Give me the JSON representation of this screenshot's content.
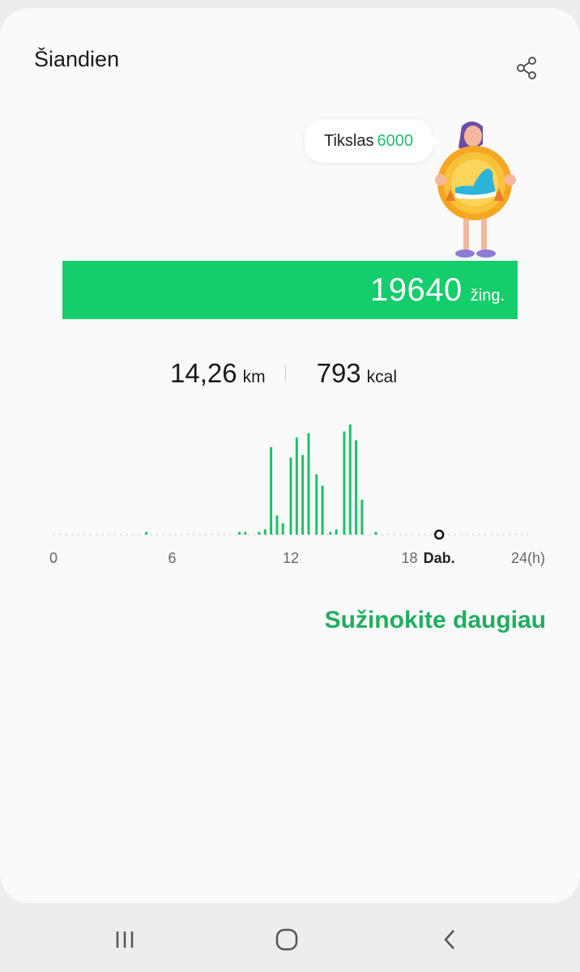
{
  "header": {
    "title": "Šiandien",
    "share_icon": "share-icon"
  },
  "goal": {
    "label": "Tikslas",
    "value": "6000",
    "value_color": "#1fbf6a"
  },
  "steps": {
    "value": "19640",
    "unit": "žing.",
    "progress_fraction": 1.0,
    "bar_color": "#14cd6b"
  },
  "stats": {
    "distance": {
      "value": "14,26",
      "unit": "km"
    },
    "calories": {
      "value": "793",
      "unit": "kcal"
    }
  },
  "chart_data": {
    "type": "bar",
    "x_ticks": [
      {
        "label": "0",
        "hour": 0
      },
      {
        "label": "6",
        "hour": 6
      },
      {
        "label": "12",
        "hour": 12
      },
      {
        "label": "18",
        "hour": 18
      },
      {
        "label": "24(h)",
        "hour": 24
      }
    ],
    "now_label": "Dab.",
    "now_hour": 19.5,
    "xlim": [
      0,
      24
    ],
    "bars": [
      {
        "hour": 4.7,
        "value": 3
      },
      {
        "hour": 9.4,
        "value": 3
      },
      {
        "hour": 9.7,
        "value": 3
      },
      {
        "hour": 10.4,
        "value": 3
      },
      {
        "hour": 10.7,
        "value": 6
      },
      {
        "hour": 11.0,
        "value": 100
      },
      {
        "hour": 11.3,
        "value": 22
      },
      {
        "hour": 11.6,
        "value": 13
      },
      {
        "hour": 12.0,
        "value": 88
      },
      {
        "hour": 12.3,
        "value": 111
      },
      {
        "hour": 12.6,
        "value": 91
      },
      {
        "hour": 12.9,
        "value": 116
      },
      {
        "hour": 13.3,
        "value": 69
      },
      {
        "hour": 13.6,
        "value": 56
      },
      {
        "hour": 14.0,
        "value": 3
      },
      {
        "hour": 14.3,
        "value": 6
      },
      {
        "hour": 14.7,
        "value": 118
      },
      {
        "hour": 15.0,
        "value": 126
      },
      {
        "hour": 15.3,
        "value": 108
      },
      {
        "hour": 15.6,
        "value": 40
      },
      {
        "hour": 16.3,
        "value": 3
      }
    ],
    "bar_color": "#1fbf6a"
  },
  "learn_more": {
    "label": "Sužinokite daugiau",
    "color": "#1fae5e"
  },
  "navbar": {
    "recents_icon": "recents-icon",
    "home_icon": "home-icon",
    "back_icon": "back-icon"
  }
}
